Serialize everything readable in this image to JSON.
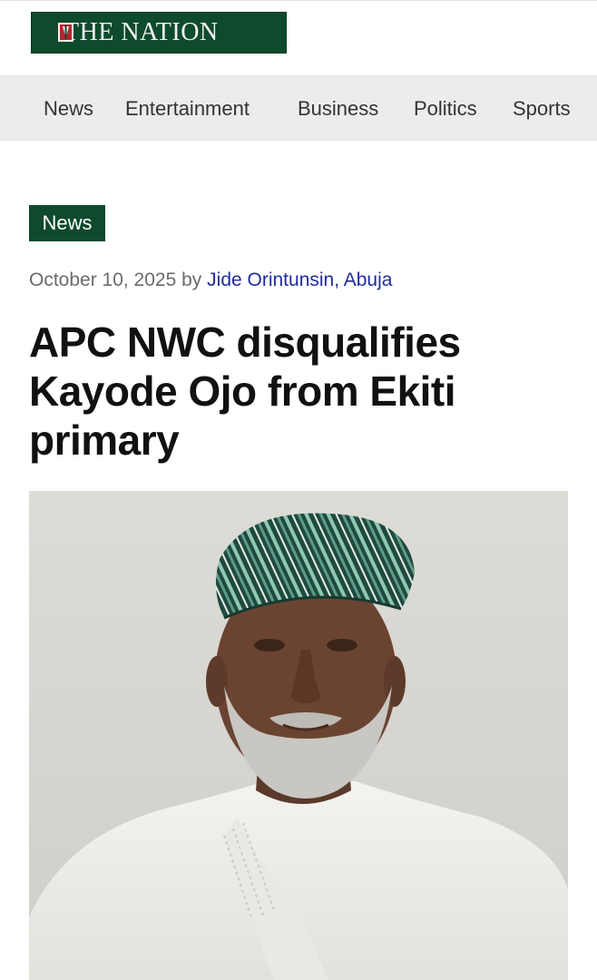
{
  "header": {
    "logo_text": "THE NATION",
    "logo_icon": "nation-emblem-icon"
  },
  "nav": {
    "items": [
      {
        "label": "News"
      },
      {
        "label": "Entertainment"
      },
      {
        "label": "Business"
      },
      {
        "label": "Politics"
      },
      {
        "label": "Sports"
      }
    ]
  },
  "article": {
    "category": "News",
    "date": "October 10, 2025",
    "by": "by",
    "author": "Jide Orintunsin, Abuja",
    "headline": "APC NWC disqualifies Kayode Ojo from Ekiti primary",
    "image_alt": "Kayode Ojo"
  },
  "colors": {
    "brand_green": "#0e4a2c",
    "nav_bg": "#ececec",
    "author_link": "#1f2d9a"
  }
}
